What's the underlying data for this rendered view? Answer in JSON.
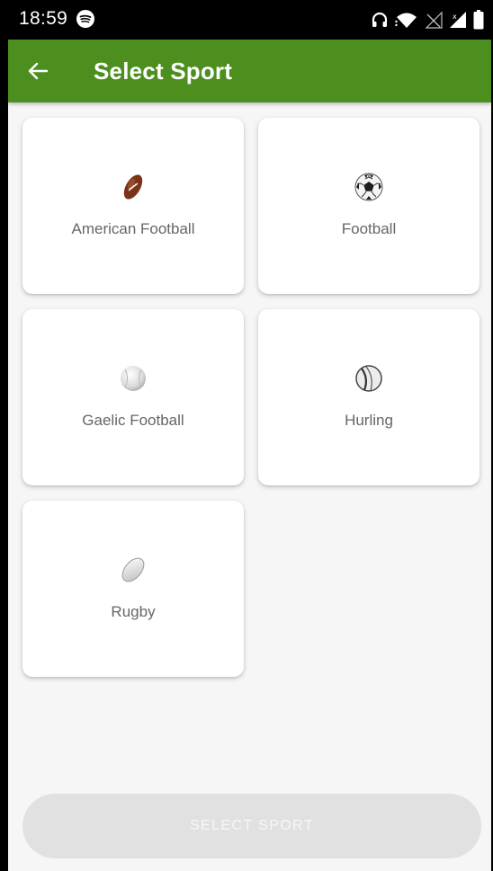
{
  "status_bar": {
    "time": "18:59",
    "icons": [
      "spotify-icon",
      "headphones-icon",
      "wifi-icon",
      "no-signal-icon",
      "signal-icon",
      "battery-icon"
    ]
  },
  "app_bar": {
    "title": "Select Sport",
    "back_icon": "arrow-left-icon"
  },
  "sports": [
    {
      "label": "American Football",
      "icon": "american-football-icon"
    },
    {
      "label": "Football",
      "icon": "soccer-ball-icon"
    },
    {
      "label": "Gaelic Football",
      "icon": "gaelic-ball-icon"
    },
    {
      "label": "Hurling",
      "icon": "hurling-ball-icon"
    },
    {
      "label": "Rugby",
      "icon": "rugby-ball-icon"
    }
  ],
  "action": {
    "select_label": "SELECT SPORT",
    "enabled": false
  },
  "colors": {
    "app_bar": "#4c8f1e",
    "button_disabled": "#e1e1e1",
    "card_text": "#666666"
  }
}
